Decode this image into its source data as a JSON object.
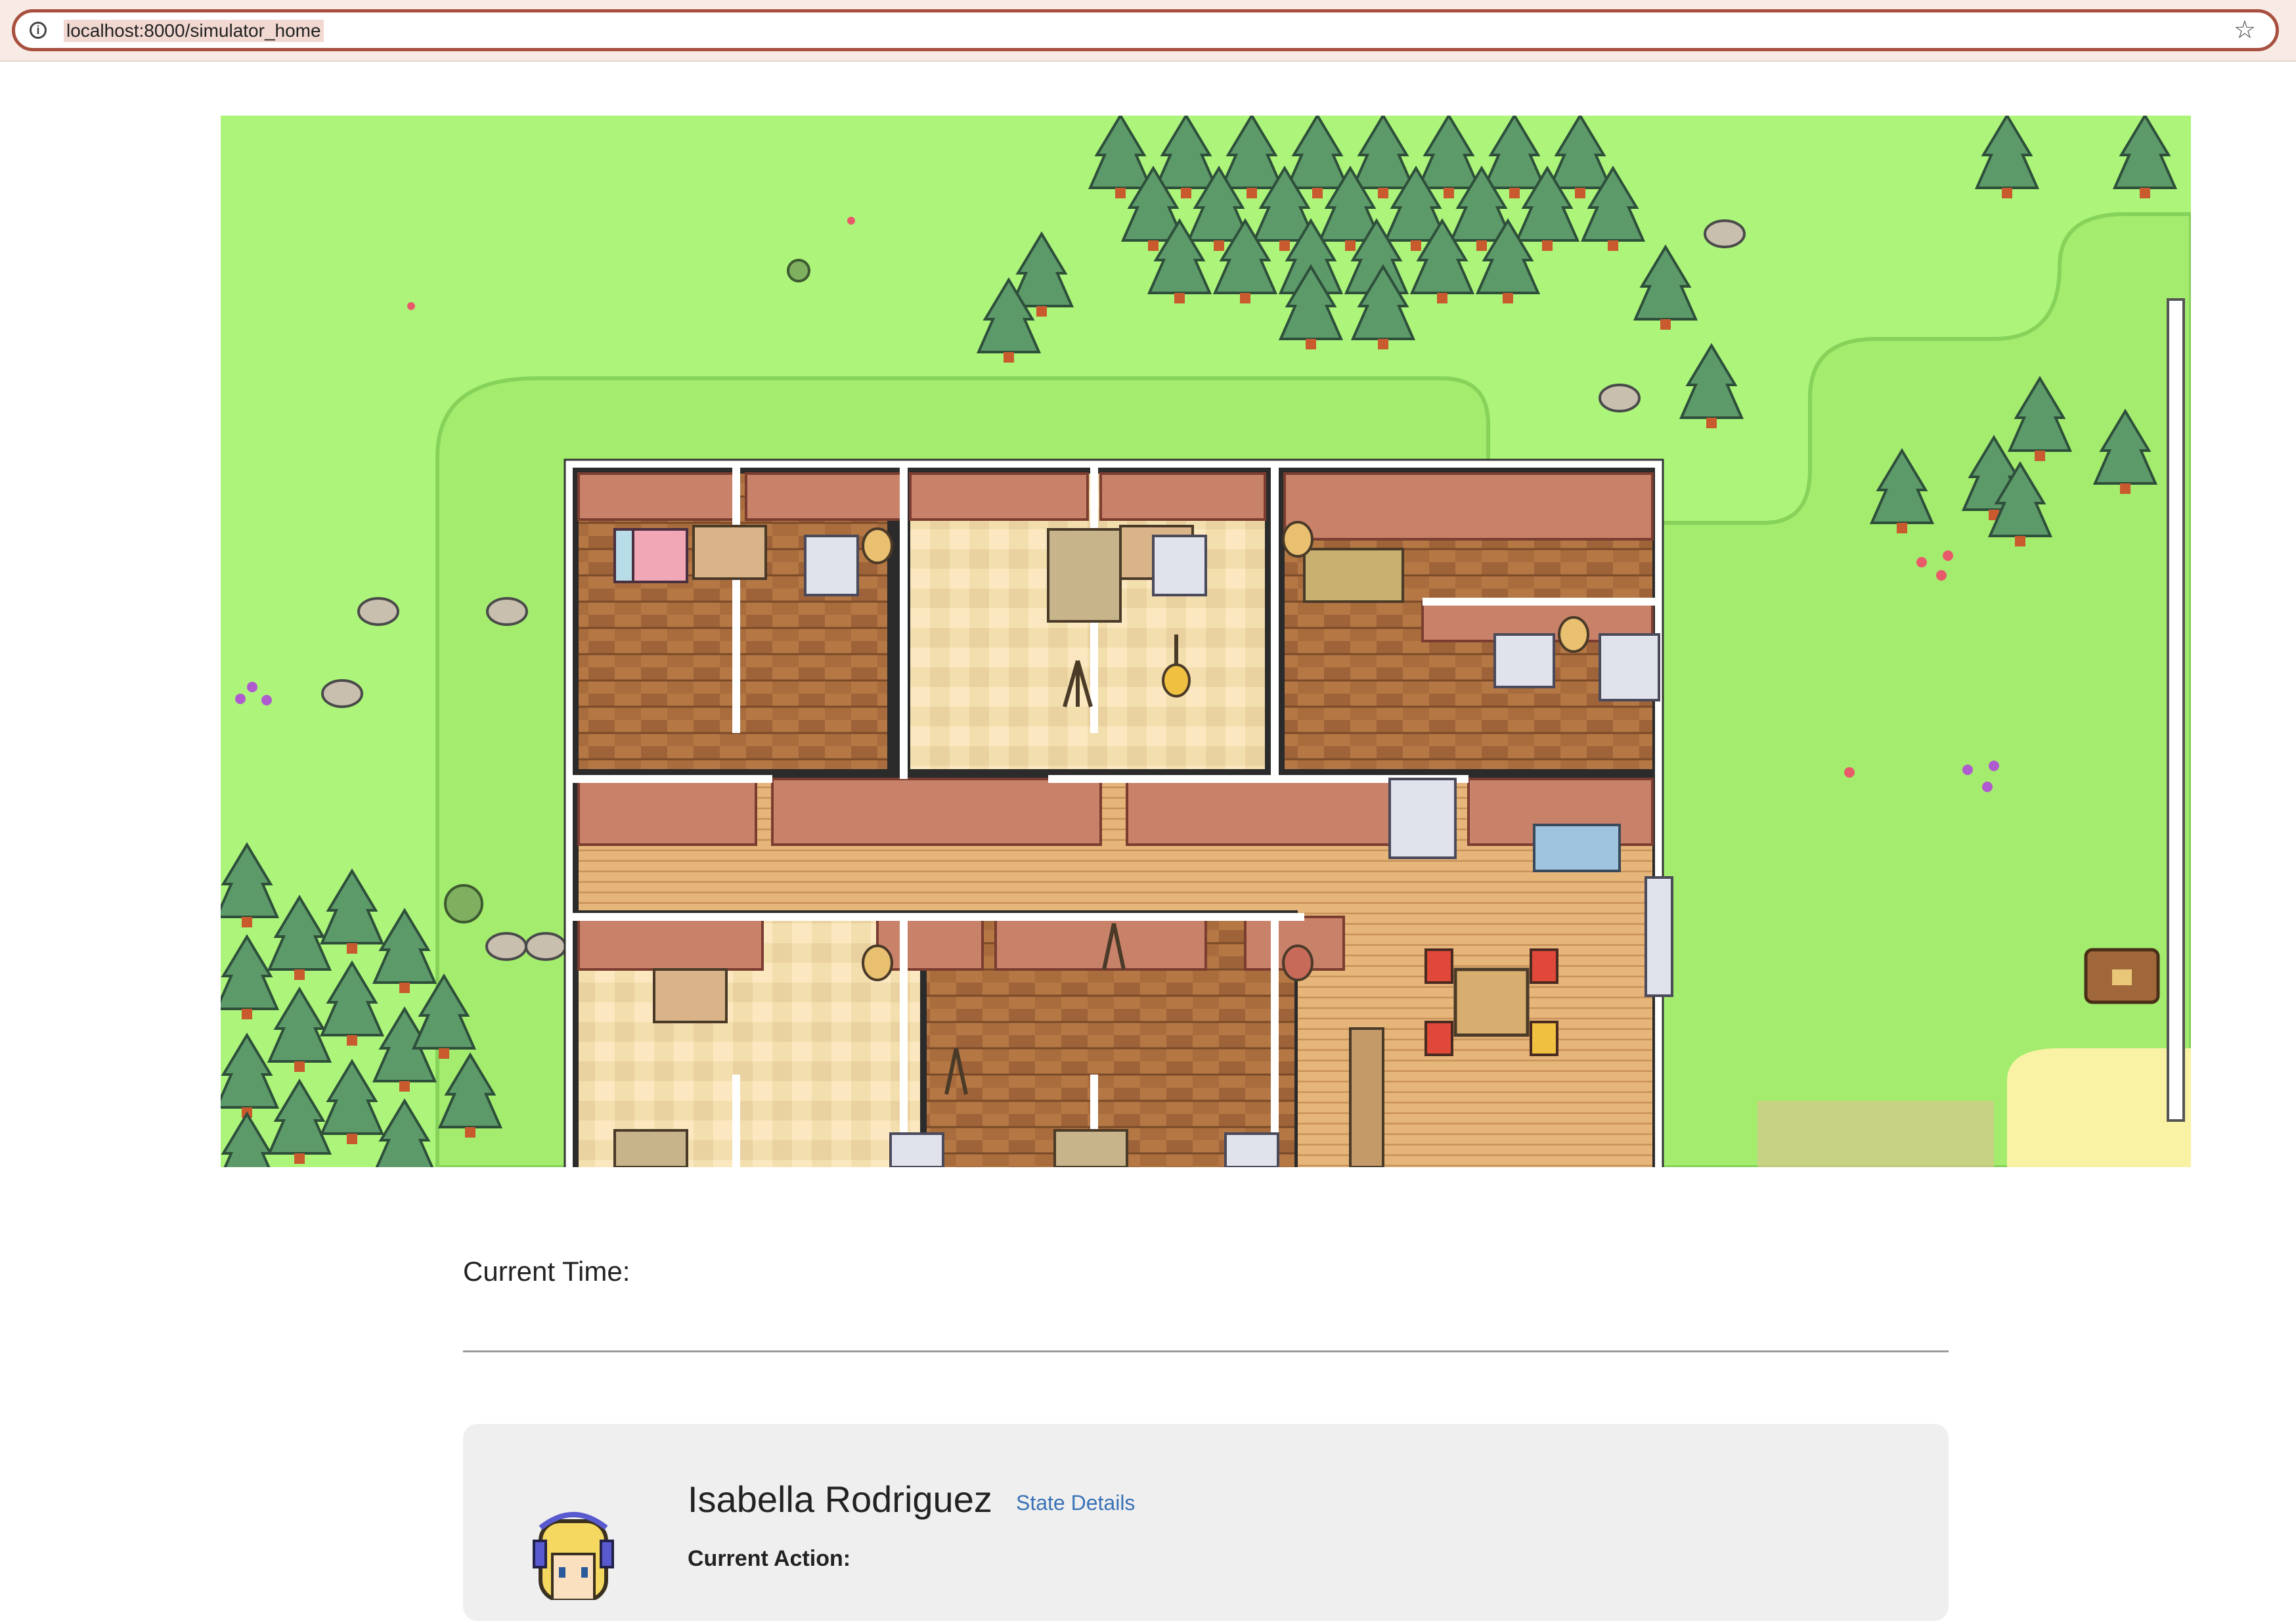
{
  "browser": {
    "url": "localhost:8000/simulator_home",
    "info_icon": "info-icon",
    "bookmark_icon": "star-icon"
  },
  "map": {
    "description_icon": "game-map"
  },
  "time": {
    "label": "Current Time:",
    "value": ""
  },
  "persona": {
    "name": "Isabella Rodriguez",
    "state_link": "State Details",
    "current_action_label": "Current Action:"
  },
  "colors": {
    "grass": "#acf57a",
    "link": "#3a72b6",
    "card_bg": "#efefef"
  }
}
